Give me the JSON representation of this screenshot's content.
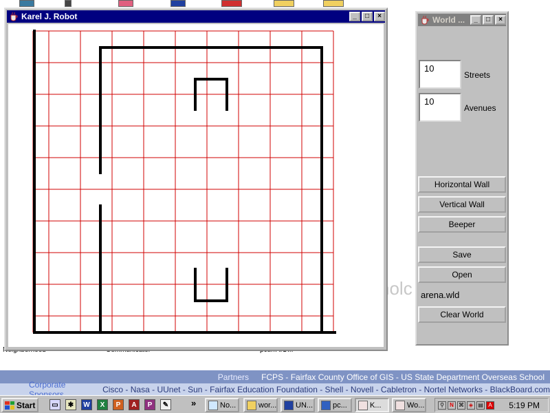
{
  "desktop": {
    "background_text": {
      "left_fragment": "Neighborhood",
      "middle_fragment": "Communicator",
      "right_fragment": "pcurrAIO...",
      "watermark": "nolc"
    }
  },
  "robot_window": {
    "title": "Karel J. Robot",
    "icon": "java-cup-icon",
    "buttons": {
      "minimize": "_",
      "maximize": "□",
      "close": "×"
    },
    "grid_color": "#d00000",
    "wall_color": "#000000"
  },
  "world_window": {
    "title": "World ...",
    "icon": "java-cup-icon",
    "buttons": {
      "minimize": "_",
      "maximize": "□",
      "close": "×"
    },
    "streets": {
      "value": "10",
      "label": "Streets"
    },
    "avenues": {
      "value": "10",
      "label": "Avenues"
    },
    "actions": {
      "horizontal_wall": "Horizontal Wall",
      "vertical_wall": "Vertical Wall",
      "beeper": "Beeper",
      "save": "Save",
      "open": "Open",
      "clear_world": "Clear World"
    },
    "file_name": "arena.wld"
  },
  "web_page": {
    "partners": {
      "label": "Partners",
      "text": "FCPS - Fairfax County Office of GIS - US State Department Overseas School"
    },
    "sponsors": {
      "label": "Corporate Sponsors",
      "text": "Cisco - Nasa - UUnet - Sun - Fairfax Education Foundation - Shell - Novell - Cabletron - Nortel Networks - BlackBoard.com"
    }
  },
  "taskbar": {
    "start_label": "Start",
    "more_label": "»",
    "tasks": [
      "No...",
      "wor...",
      "UN...",
      "pc...",
      "K...",
      "Wo..."
    ],
    "clock": "5:19 PM"
  }
}
